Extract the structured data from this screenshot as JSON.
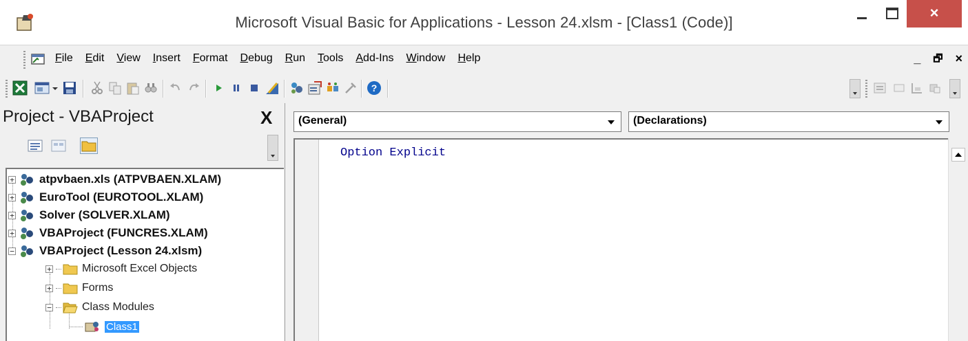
{
  "window": {
    "title": "Microsoft Visual Basic for Applications - Lesson 24.xlsm - [Class1 (Code)]",
    "close_glyph": "×",
    "accent_close": "#c7504a"
  },
  "menubar": {
    "items": [
      "File",
      "Edit",
      "View",
      "Insert",
      "Format",
      "Debug",
      "Run",
      "Tools",
      "Add-Ins",
      "Window",
      "Help"
    ],
    "mdi_min": "_",
    "mdi_restore": "🗗",
    "mdi_close": "×"
  },
  "toolbar": {
    "icons": [
      "view-excel-icon",
      "insert-userform-icon",
      "dropdown-arrow-icon",
      "save-icon",
      "cut-icon",
      "copy-icon",
      "paste-icon",
      "find-icon",
      "undo-icon",
      "redo-icon",
      "run-icon",
      "break-icon",
      "reset-icon",
      "design-mode-icon",
      "project-explorer-icon",
      "properties-window-icon",
      "object-browser-icon",
      "toolbox-icon",
      "help-icon"
    ]
  },
  "project": {
    "title": "Project - VBAProject",
    "close_glyph": "X",
    "tree": [
      {
        "label": "atpvbaen.xls (ATPVBAEN.XLAM)",
        "expander": "+"
      },
      {
        "label": "EuroTool (EUROTOOL.XLAM)",
        "expander": "+"
      },
      {
        "label": "Solver (SOLVER.XLAM)",
        "expander": "+"
      },
      {
        "label": "VBAProject (FUNCRES.XLAM)",
        "expander": "+"
      },
      {
        "label": "VBAProject (Lesson 24.xlsm)",
        "expander": "−"
      }
    ],
    "folders": [
      {
        "label": "Microsoft Excel Objects",
        "expander": "+"
      },
      {
        "label": "Forms",
        "expander": "+"
      },
      {
        "label": "Class Modules",
        "expander": "−"
      }
    ],
    "selected_item": "Class1",
    "selection_color": "#3399ff"
  },
  "code": {
    "object_combo": "(General)",
    "procedure_combo": "(Declarations)",
    "lines": [
      "Option Explicit"
    ],
    "keyword_color": "#00008b"
  }
}
